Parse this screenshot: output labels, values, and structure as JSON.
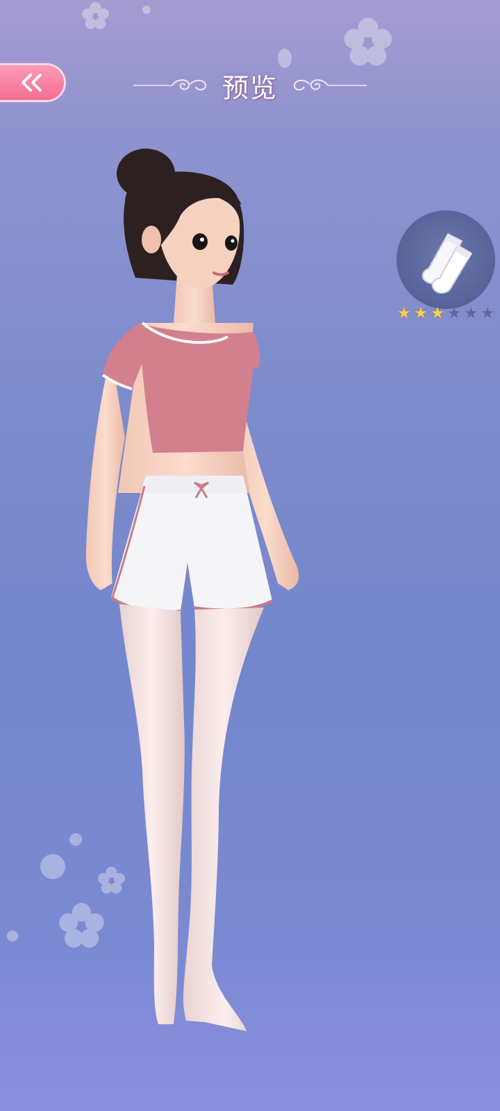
{
  "header": {
    "title": "预览"
  },
  "item": {
    "icon": "white-stockings-icon",
    "rating": 3,
    "max_rating": 6
  },
  "colors": {
    "accent": "#f26d92",
    "star_on": "#f5d05e",
    "star_off": "#5d6a98"
  }
}
